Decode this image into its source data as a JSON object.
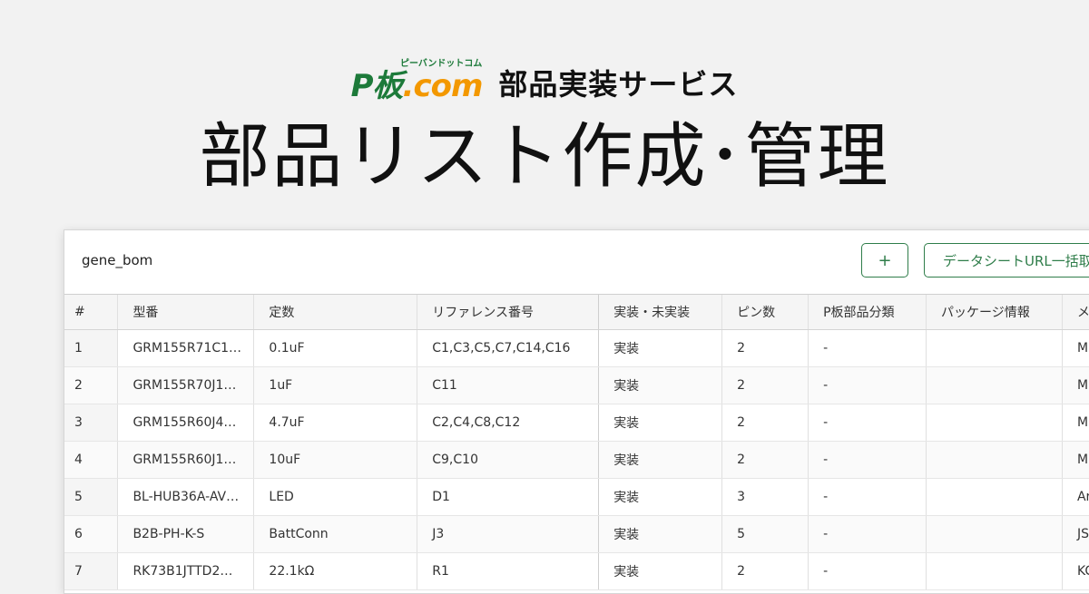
{
  "brand": {
    "logo_p": "P",
    "logo_ita": "板",
    "logo_dot": ".",
    "logo_com": "com",
    "logo_ruby": "ピーバンドットコム",
    "service": "部品実装サービス"
  },
  "headline": "部品リスト作成･管理",
  "panel": {
    "project_name": "gene_bom",
    "add_button": "+",
    "fetch_button": "データシートURL一括取得"
  },
  "table": {
    "headers": [
      "#",
      "型番",
      "定数",
      "リファレンス番号",
      "実装・未実装",
      "ピン数",
      "P板部品分類",
      "パッケージ情報",
      "メ"
    ],
    "rows": [
      [
        "1",
        "GRM155R71C1…",
        "0.1uF",
        "C1,C3,C5,C7,C14,C16",
        "実装",
        "2",
        "-",
        "",
        "Mu"
      ],
      [
        "2",
        "GRM155R70J1…",
        "1uF",
        "C11",
        "実装",
        "2",
        "-",
        "",
        "Mu"
      ],
      [
        "3",
        "GRM155R60J4…",
        "4.7uF",
        "C2,C4,C8,C12",
        "実装",
        "2",
        "-",
        "",
        "Mu"
      ],
      [
        "4",
        "GRM155R60J1…",
        "10uF",
        "C9,C10",
        "実装",
        "2",
        "-",
        "",
        "Mu"
      ],
      [
        "5",
        "BL-HUB36A-AV…",
        "LED",
        "D1",
        "実装",
        "3",
        "-",
        "",
        "Ar"
      ],
      [
        "6",
        "B2B-PH-K-S",
        "BattConn",
        "J3",
        "実装",
        "5",
        "-",
        "",
        "JS"
      ],
      [
        "7",
        "RK73B1JTTD2…",
        "22.1kΩ",
        "R1",
        "実装",
        "2",
        "-",
        "",
        "KC"
      ]
    ]
  }
}
